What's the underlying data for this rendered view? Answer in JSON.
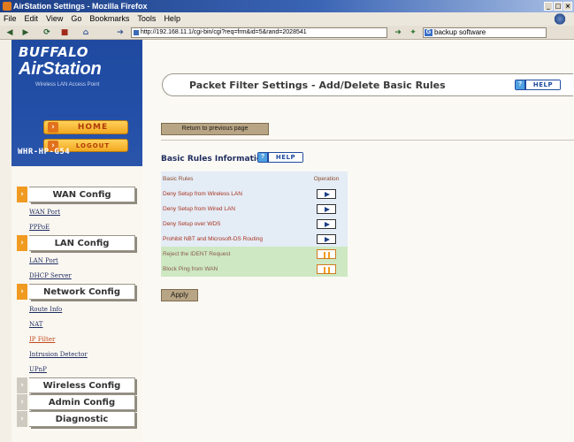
{
  "window": {
    "title": "AirStation Settings - Mozilla Firefox",
    "controls": [
      "_",
      "□",
      "×"
    ]
  },
  "menubar": {
    "items": [
      "File",
      "Edit",
      "View",
      "Go",
      "Bookmarks",
      "Tools",
      "Help"
    ]
  },
  "navbar": {
    "url": "http://192.168.11.1/cgi-bin/cgi?req=frm&id=5&rand=2028541",
    "search_value": "backup software"
  },
  "sidebar": {
    "logo_top": "BUFFALO",
    "logo_main": "AirStation",
    "logo_tag": "Wireless LAN Access Point",
    "home_label": "HOME",
    "logout_label": "LOGOUT",
    "model": "WHR-HP-G54",
    "sections": [
      {
        "label": "WAN Config",
        "active": true,
        "items": [
          "WAN Port",
          "PPPoE"
        ]
      },
      {
        "label": "LAN Config",
        "active": true,
        "items": [
          "LAN Port",
          "DHCP Server"
        ]
      },
      {
        "label": "Network Config",
        "active": true,
        "items": [
          "Route Info",
          "NAT",
          "IP Filter",
          "Intrusion Detector",
          "UPnP"
        ]
      },
      {
        "label": "Wireless Config",
        "active": false,
        "items": []
      },
      {
        "label": "Admin Config",
        "active": false,
        "items": []
      },
      {
        "label": "Diagnostic",
        "active": false,
        "items": []
      }
    ],
    "current_item": "IP Filter"
  },
  "main": {
    "page_title": "Packet Filter Settings - Add/Delete Basic Rules",
    "help_label": "HELP",
    "return_label": "Return to previous page",
    "section_title": "Basic Rules Information",
    "section_help_label": "HELP",
    "table_headers": [
      "Basic Rules",
      "Operation"
    ],
    "rules": [
      {
        "name": "Deny Setup from Wireless LAN",
        "state": "add"
      },
      {
        "name": "Deny Setup from Wired LAN",
        "state": "add"
      },
      {
        "name": "Deny Setup over WDS",
        "state": "add"
      },
      {
        "name": "Prohibit NBT and Microsoft-DS Routing",
        "state": "add"
      },
      {
        "name": "Reject the IDENT Request",
        "state": "enabled"
      },
      {
        "name": "Block Ping from WAN",
        "state": "enabled"
      }
    ],
    "apply_label": "Apply"
  },
  "colors": {
    "brand_blue": "#1f4aa0",
    "accent_orange": "#f09a21",
    "active_row_green": "#cde8c2",
    "rule_text_red": "#a8331e"
  }
}
